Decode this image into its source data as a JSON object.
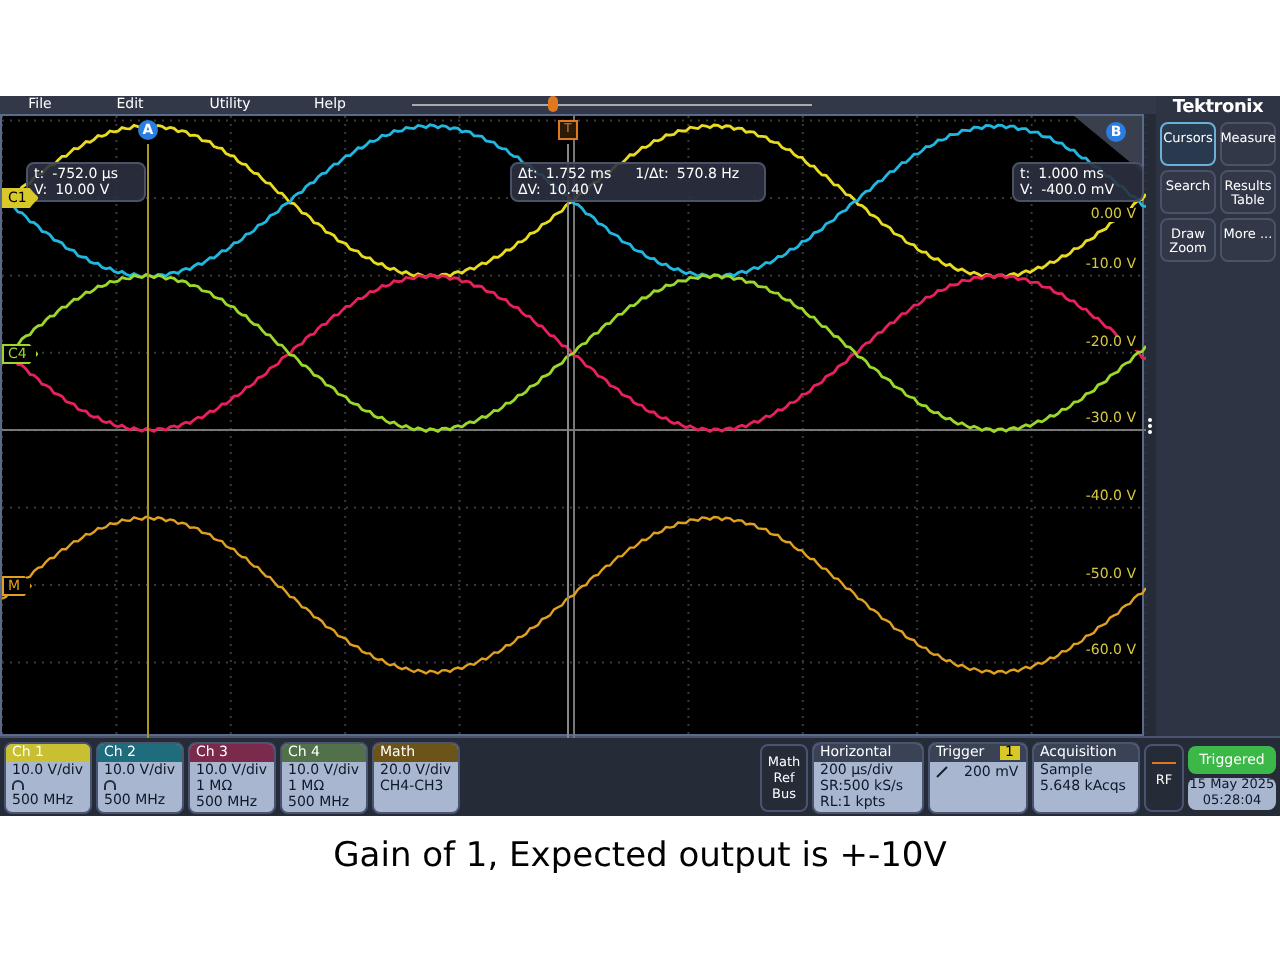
{
  "menu": [
    "File",
    "Edit",
    "Utility",
    "Help"
  ],
  "timeline": {
    "level": 0.35
  },
  "logo": "Tektronix",
  "side_buttons": [
    {
      "label": "Cursors",
      "selected": true
    },
    {
      "label": "Measure",
      "selected": false
    },
    {
      "label": "Search",
      "selected": false
    },
    {
      "label": "Results Table",
      "selected": false
    },
    {
      "label": "Draw Zoom",
      "selected": false
    },
    {
      "label": "More ...",
      "selected": false
    }
  ],
  "axis_labels": [
    "0.00 V",
    "-10.0 V",
    "-20.0 V",
    "-30.0 V",
    "-40.0 V",
    "-50.0 V",
    "-60.0 V"
  ],
  "cursors": {
    "a": "A",
    "b": "B",
    "trigger": "T"
  },
  "readouts": [
    {
      "rows": [
        [
          {
            "label": "t:",
            "value": "-752.0 µs"
          }
        ],
        [
          {
            "label": "V:",
            "value": "10.00 V"
          }
        ]
      ]
    },
    {
      "rows": [
        [
          {
            "label": "Δt:",
            "value": "1.752 ms"
          },
          {
            "label": "1/Δt:",
            "value": "570.8 Hz"
          }
        ],
        [
          {
            "label": "ΔV:",
            "value": "10.40 V"
          }
        ]
      ]
    },
    {
      "rows": [
        [
          {
            "label": "t:",
            "value": "1.000 ms"
          }
        ],
        [
          {
            "label": "V:",
            "value": "-400.0 mV"
          }
        ]
      ]
    }
  ],
  "trace_markers": [
    {
      "label": "C1",
      "kind": "filled",
      "color": "#d8c82a"
    },
    {
      "label": "C4",
      "kind": "outline",
      "color": "#9cd82a"
    },
    {
      "label": "M",
      "kind": "outline",
      "color": "#e0a020"
    }
  ],
  "channels": [
    {
      "name": "Ch 1",
      "color": "#c8c030",
      "kind": "probe",
      "lines": [
        "10.0 V/div",
        "500 MHz"
      ]
    },
    {
      "name": "Ch 2",
      "color": "#1e6c7c",
      "kind": "probe",
      "lines": [
        "10.0 V/div",
        "500 MHz"
      ]
    },
    {
      "name": "Ch 3",
      "color": "#7c2a4c",
      "kind": "plain",
      "lines": [
        "10.0 V/div",
        "1 MΩ",
        "500 MHz"
      ]
    },
    {
      "name": "Ch 4",
      "color": "#52704a",
      "kind": "plain",
      "lines": [
        "10.0 V/div",
        "1 MΩ",
        "500 MHz"
      ]
    },
    {
      "name": "Math",
      "color": "#6c5418",
      "kind": "plain",
      "lines": [
        "20.0 V/div",
        "CH4-CH3"
      ]
    }
  ],
  "math_ref_bus": [
    "Math",
    "Ref",
    "Bus"
  ],
  "horizontal": {
    "title": "Horizontal",
    "lines": [
      "200 µs/div",
      "SR:500 kS/s",
      "RL:1 kpts"
    ]
  },
  "trigger": {
    "title": "Trigger",
    "source": "1",
    "level": "200 mV"
  },
  "acquisition": {
    "title": "Acquisition",
    "lines": [
      "Sample",
      "5.648 kAcqs"
    ]
  },
  "rf": "RF",
  "status": "Triggered",
  "date": [
    "15 May 2025",
    "05:28:04"
  ],
  "caption": "Gain of 1, Expected output is +-10V"
}
